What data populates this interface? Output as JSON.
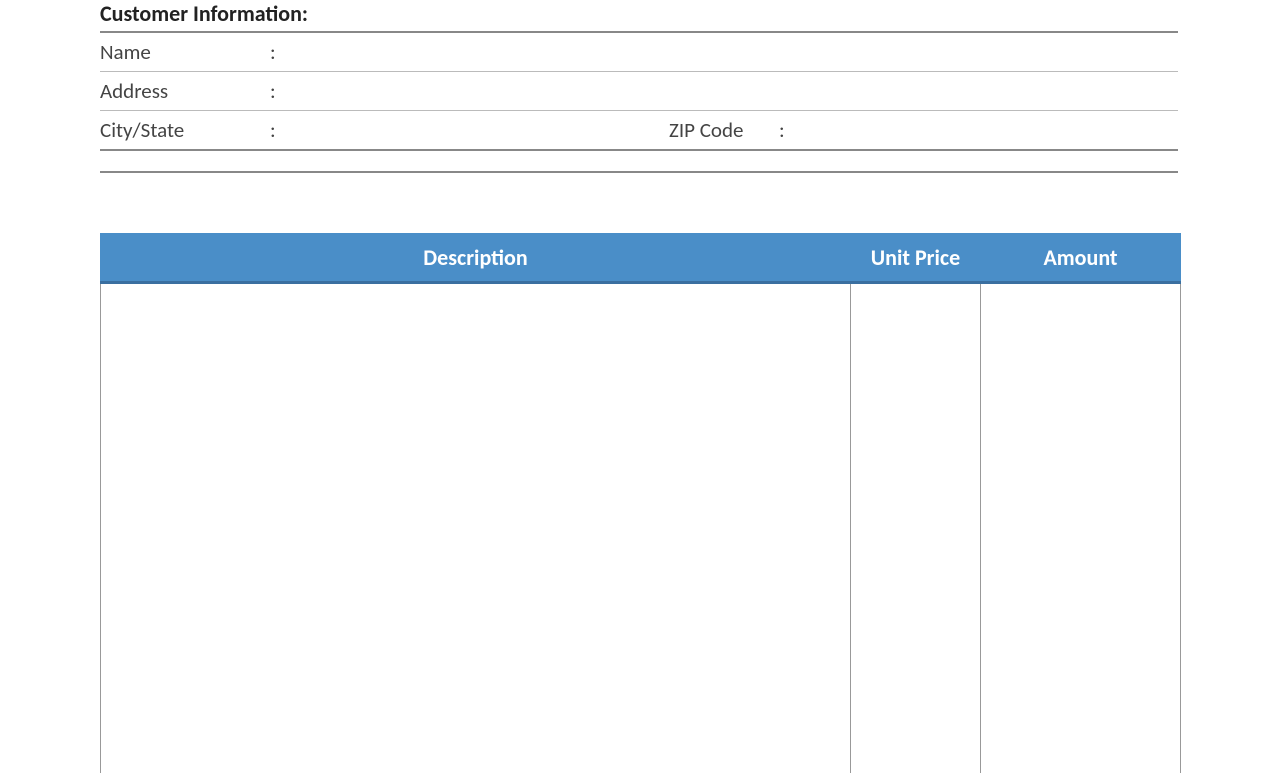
{
  "customer": {
    "section_title": "Customer Information:",
    "fields": {
      "name_label": "Name",
      "name_value": "",
      "address_label": "Address",
      "address_value": "",
      "city_state_label": "City/State",
      "city_state_value": "",
      "zip_label": "ZIP Code",
      "zip_value": ""
    },
    "colon": ":"
  },
  "items": {
    "headers": {
      "description": "Description",
      "unit_price": "Unit Price",
      "amount": "Amount"
    },
    "rows": []
  }
}
